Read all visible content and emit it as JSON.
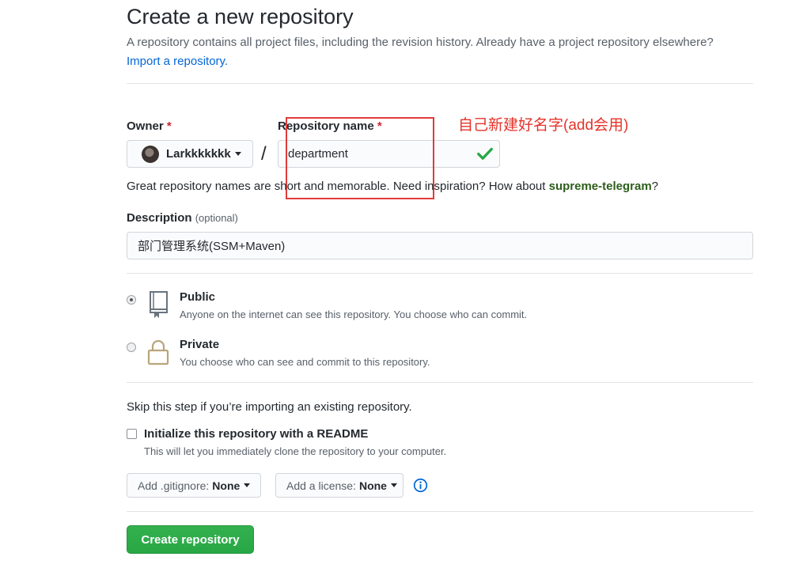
{
  "header": {
    "title": "Create a new repository",
    "subtitle": "A repository contains all project files, including the revision history. Already have a project repository elsewhere?",
    "import_link": "Import a repository."
  },
  "owner": {
    "label": "Owner",
    "required_mark": "*",
    "value": "Larkkkkkkk"
  },
  "slash": "/",
  "repo_name": {
    "label": "Repository name",
    "required_mark": "*",
    "value": "department"
  },
  "annotation": "自己新建好名字(add会用)",
  "hint": {
    "before": "Great repository names are short and memorable. Need inspiration? How about ",
    "suggestion": "supreme-telegram",
    "after": "?"
  },
  "description": {
    "label": "Description",
    "optional": "(optional)",
    "value": "部门管理系统(SSM+Maven)"
  },
  "visibility": {
    "public": {
      "title": "Public",
      "desc": "Anyone on the internet can see this repository. You choose who can commit.",
      "checked": true
    },
    "private": {
      "title": "Private",
      "desc": "You choose who can see and commit to this repository.",
      "checked": false
    }
  },
  "init": {
    "skip_text": "Skip this step if you’re importing an existing repository.",
    "readme_title": "Initialize this repository with a README",
    "readme_desc": "This will let you immediately clone the repository to your computer.",
    "readme_checked": false
  },
  "gitignore": {
    "label": "Add .gitignore:",
    "value": "None"
  },
  "license": {
    "label": "Add a license:",
    "value": "None"
  },
  "create_button": "Create repository",
  "colors": {
    "accent_link": "#0366d6",
    "create_button": "#28a745",
    "valid_check": "#28a745",
    "required": "#cb2431",
    "annotation": "#e5332a"
  }
}
